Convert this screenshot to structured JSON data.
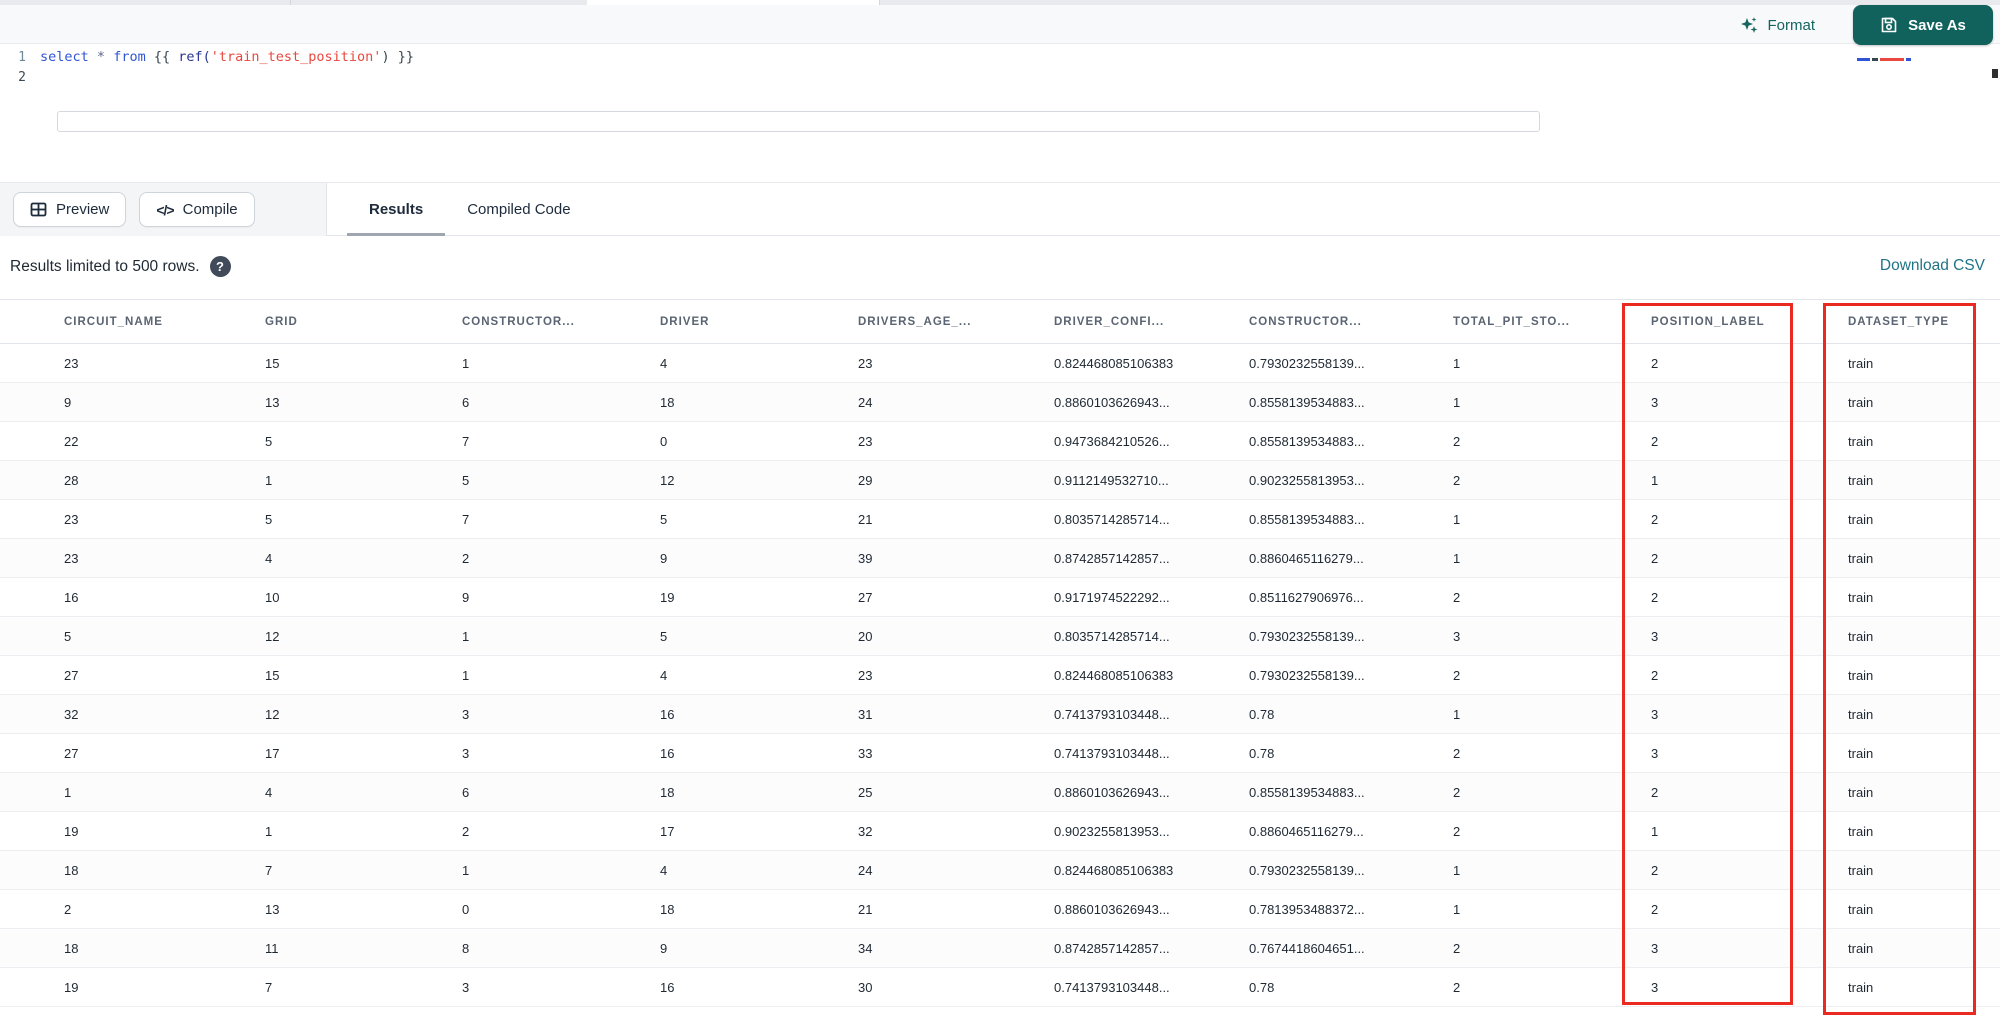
{
  "toolbar": {
    "format_label": "Format",
    "save_as_label": "Save As"
  },
  "editor": {
    "line_numbers": [
      "1",
      "2"
    ],
    "code_tokens": [
      {
        "text": "select",
        "type": "keyword"
      },
      {
        "text": " ",
        "type": "plain"
      },
      {
        "text": "*",
        "type": "operator"
      },
      {
        "text": " ",
        "type": "plain"
      },
      {
        "text": "from",
        "type": "keyword"
      },
      {
        "text": " {{ ",
        "type": "plain"
      },
      {
        "text": "ref(",
        "type": "function"
      },
      {
        "text": "'train_test_position'",
        "type": "string"
      },
      {
        "text": ") }}",
        "type": "plain"
      }
    ]
  },
  "actionbar": {
    "preview_label": "Preview",
    "compile_label": "Compile",
    "tabs": [
      {
        "label": "Results",
        "active": true
      },
      {
        "label": "Compiled Code",
        "active": false
      }
    ]
  },
  "results_meta": {
    "limit_text": "Results limited to 500 rows.",
    "help_glyph": "?",
    "download_label": "Download CSV"
  },
  "table": {
    "columns": [
      "CIRCUIT_NAME",
      "GRID",
      "CONSTRUCTOR...",
      "DRIVER",
      "DRIVERS_AGE_...",
      "DRIVER_CONFI...",
      "CONSTRUCTOR...",
      "TOTAL_PIT_STO...",
      "POSITION_LABEL",
      "DATASET_TYPE"
    ],
    "rows": [
      [
        "23",
        "15",
        "1",
        "4",
        "23",
        "0.824468085106383",
        "0.7930232558139...",
        "1",
        "2",
        "train"
      ],
      [
        "9",
        "13",
        "6",
        "18",
        "24",
        "0.8860103626943...",
        "0.8558139534883...",
        "1",
        "3",
        "train"
      ],
      [
        "22",
        "5",
        "7",
        "0",
        "23",
        "0.9473684210526...",
        "0.8558139534883...",
        "2",
        "2",
        "train"
      ],
      [
        "28",
        "1",
        "5",
        "12",
        "29",
        "0.9112149532710...",
        "0.9023255813953...",
        "2",
        "1",
        "train"
      ],
      [
        "23",
        "5",
        "7",
        "5",
        "21",
        "0.8035714285714...",
        "0.8558139534883...",
        "1",
        "2",
        "train"
      ],
      [
        "23",
        "4",
        "2",
        "9",
        "39",
        "0.8742857142857...",
        "0.8860465116279...",
        "1",
        "2",
        "train"
      ],
      [
        "16",
        "10",
        "9",
        "19",
        "27",
        "0.9171974522292...",
        "0.8511627906976...",
        "2",
        "2",
        "train"
      ],
      [
        "5",
        "12",
        "1",
        "5",
        "20",
        "0.8035714285714...",
        "0.7930232558139...",
        "3",
        "3",
        "train"
      ],
      [
        "27",
        "15",
        "1",
        "4",
        "23",
        "0.824468085106383",
        "0.7930232558139...",
        "2",
        "2",
        "train"
      ],
      [
        "32",
        "12",
        "3",
        "16",
        "31",
        "0.7413793103448...",
        "0.78",
        "1",
        "3",
        "train"
      ],
      [
        "27",
        "17",
        "3",
        "16",
        "33",
        "0.7413793103448...",
        "0.78",
        "2",
        "3",
        "train"
      ],
      [
        "1",
        "4",
        "6",
        "18",
        "25",
        "0.8860103626943...",
        "0.8558139534883...",
        "2",
        "2",
        "train"
      ],
      [
        "19",
        "1",
        "2",
        "17",
        "32",
        "0.9023255813953...",
        "0.8860465116279...",
        "2",
        "1",
        "train"
      ],
      [
        "18",
        "7",
        "1",
        "4",
        "24",
        "0.824468085106383",
        "0.7930232558139...",
        "1",
        "2",
        "train"
      ],
      [
        "2",
        "13",
        "0",
        "18",
        "21",
        "0.8860103626943...",
        "0.7813953488372...",
        "1",
        "2",
        "train"
      ],
      [
        "18",
        "11",
        "8",
        "9",
        "34",
        "0.8742857142857...",
        "0.7674418604651...",
        "2",
        "3",
        "train"
      ],
      [
        "19",
        "7",
        "3",
        "16",
        "30",
        "0.7413793103448...",
        "0.78",
        "2",
        "3",
        "train"
      ]
    ]
  },
  "annotations": {
    "highlight_color": "#ea2a21",
    "highlighted_columns": [
      "POSITION_LABEL",
      "DATASET_TYPE"
    ]
  },
  "colors": {
    "save_as_bg": "#11625d",
    "format_teal": "#15655f",
    "download_link": "#1f7487",
    "keyword_blue": "#2f55d4",
    "string_red": "#e8483f"
  }
}
